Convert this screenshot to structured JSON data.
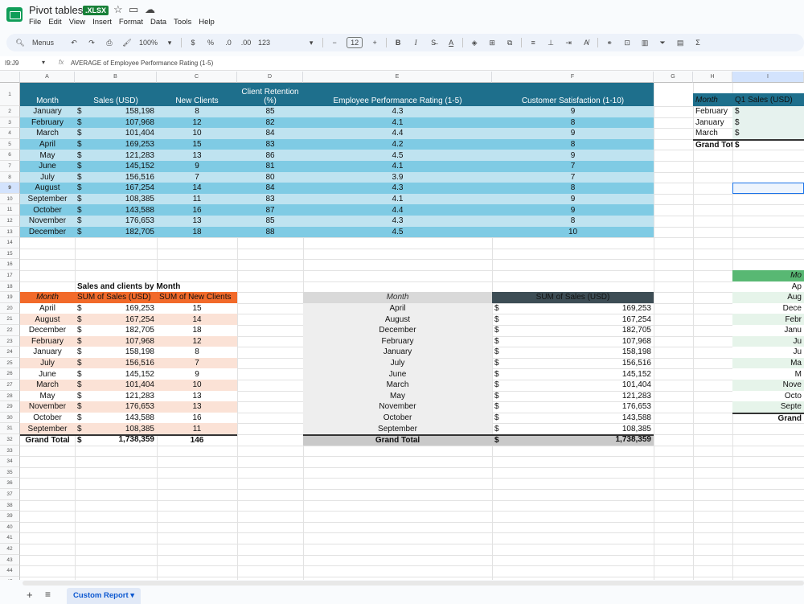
{
  "doc": {
    "title": "Pivot tables",
    "format_badge": ".XLSX"
  },
  "menu": [
    "File",
    "Edit",
    "View",
    "Insert",
    "Format",
    "Data",
    "Tools",
    "Help"
  ],
  "toolbar": {
    "search_label": "Menus",
    "zoom": "100%",
    "currency": "$",
    "percent": "%",
    "dec_less": ".0",
    "dec_more": ".00",
    "number_format": "123",
    "font_size": "12"
  },
  "formula_bar": {
    "cell_ref": "I9:J9",
    "formula": "AVERAGE of  Employee Performance Rating (1-5)"
  },
  "columns": [
    "A",
    "B",
    "C",
    "D",
    "E",
    "F",
    "G",
    "H",
    "I"
  ],
  "rows": [
    "1",
    "2",
    "3",
    "4",
    "5",
    "6",
    "7",
    "8",
    "9",
    "10",
    "11",
    "12",
    "13",
    "14",
    "15",
    "16",
    "17",
    "18",
    "19",
    "20",
    "21",
    "22",
    "23",
    "24",
    "25",
    "26",
    "27",
    "28",
    "29",
    "30",
    "31",
    "32",
    "33",
    "34",
    "35",
    "36",
    "37",
    "38",
    "39",
    "40",
    "41",
    "42",
    "43",
    "44",
    "45"
  ],
  "main_table": {
    "headers": [
      "Month",
      "Sales (USD)",
      "New Clients",
      "Client Retention (%)",
      "Employee Performance Rating (1-5)",
      "Customer Satisfaction (1-10)"
    ],
    "rows": [
      [
        "January",
        "$",
        "158,198",
        "8",
        "85",
        "4.3",
        "9"
      ],
      [
        "February",
        "$",
        "107,968",
        "12",
        "82",
        "4.1",
        "8"
      ],
      [
        "March",
        "$",
        "101,404",
        "10",
        "84",
        "4.4",
        "9"
      ],
      [
        "April",
        "$",
        "169,253",
        "15",
        "83",
        "4.2",
        "8"
      ],
      [
        "May",
        "$",
        "121,283",
        "13",
        "86",
        "4.5",
        "9"
      ],
      [
        "June",
        "$",
        "145,152",
        "9",
        "81",
        "4.1",
        "7"
      ],
      [
        "July",
        "$",
        "156,516",
        "7",
        "80",
        "3.9",
        "7"
      ],
      [
        "August",
        "$",
        "167,254",
        "14",
        "84",
        "4.3",
        "8"
      ],
      [
        "September",
        "$",
        "108,385",
        "11",
        "83",
        "4.1",
        "9"
      ],
      [
        "October",
        "$",
        "143,588",
        "16",
        "87",
        "4.4",
        "9"
      ],
      [
        "November",
        "$",
        "176,653",
        "13",
        "85",
        "4.3",
        "8"
      ],
      [
        "December",
        "$",
        "182,705",
        "18",
        "88",
        "4.5",
        "10"
      ]
    ]
  },
  "pivot1": {
    "title": "Sales and clients by Month",
    "headers": [
      "Month",
      "SUM of  Sales (USD)",
      "SUM of  New Clients"
    ],
    "rows": [
      [
        "April",
        "$",
        "169,253",
        "15"
      ],
      [
        "August",
        "$",
        "167,254",
        "14"
      ],
      [
        "December",
        "$",
        "182,705",
        "18"
      ],
      [
        "February",
        "$",
        "107,968",
        "12"
      ],
      [
        "January",
        "$",
        "158,198",
        "8"
      ],
      [
        "July",
        "$",
        "156,516",
        "7"
      ],
      [
        "June",
        "$",
        "145,152",
        "9"
      ],
      [
        "March",
        "$",
        "101,404",
        "10"
      ],
      [
        "May",
        "$",
        "121,283",
        "13"
      ],
      [
        "November",
        "$",
        "176,653",
        "13"
      ],
      [
        "October",
        "$",
        "143,588",
        "16"
      ],
      [
        "September",
        "$",
        "108,385",
        "11"
      ]
    ],
    "total": [
      "Grand Total",
      "$",
      "1,738,359",
      "146"
    ]
  },
  "pivot2": {
    "headers": [
      "Month",
      "SUM of  Sales (USD)"
    ],
    "rows": [
      [
        "April",
        "$",
        "169,253"
      ],
      [
        "August",
        "$",
        "167,254"
      ],
      [
        "December",
        "$",
        "182,705"
      ],
      [
        "February",
        "$",
        "107,968"
      ],
      [
        "January",
        "$",
        "158,198"
      ],
      [
        "July",
        "$",
        "156,516"
      ],
      [
        "June",
        "$",
        "145,152"
      ],
      [
        "March",
        "$",
        "101,404"
      ],
      [
        "May",
        "$",
        "121,283"
      ],
      [
        "November",
        "$",
        "176,653"
      ],
      [
        "October",
        "$",
        "143,588"
      ],
      [
        "September",
        "$",
        "108,385"
      ]
    ],
    "total": [
      "Grand Total",
      "$",
      "1,738,359"
    ]
  },
  "pivot3": {
    "headers": [
      "Month",
      "Q1 Sales (USD)"
    ],
    "rows": [
      [
        "February",
        "$"
      ],
      [
        "January",
        "$"
      ],
      [
        "March",
        "$"
      ]
    ],
    "total": [
      "Grand Tot",
      "$"
    ]
  },
  "pivot4": {
    "header": "Mo",
    "rows": [
      "Ap",
      "Aug",
      "Dece",
      "Febr",
      "Janu",
      "Ju",
      "Ju",
      "Ma",
      "M",
      "Nove",
      "Octo",
      "Septe"
    ],
    "total": "Grand"
  },
  "sheets": {
    "active": "Custom Report"
  },
  "colors": {
    "header_teal": "#1e6f8c",
    "row_light": "#bfe3f0",
    "row_dark": "#7fcbe4",
    "pivot1_header": "#f26a2a",
    "pivot1_band": "#fbe2d6",
    "pivot2_month_bg": "#eeeeee",
    "pivot2_header_dark": "#3d4d55",
    "pivot3_header": "#1e6f8c",
    "pivot4_header": "#58b873"
  }
}
